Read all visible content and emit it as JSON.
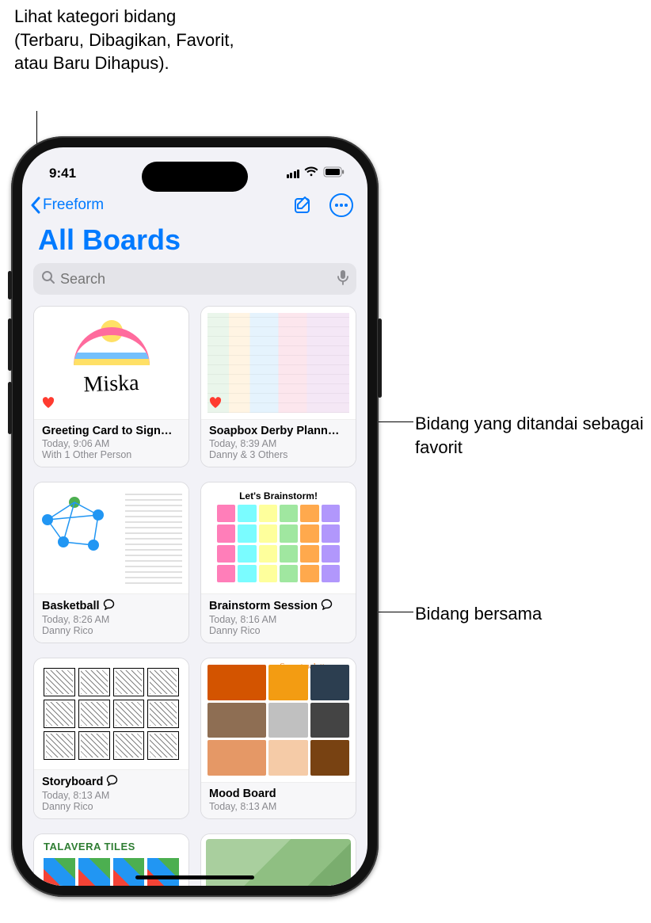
{
  "callouts": {
    "top": "Lihat kategori bidang (Terbaru, Dibagikan, Favorit, atau Baru Dihapus).",
    "favorite": "Bidang yang ditandai sebagai favorit",
    "shared": "Bidang bersama"
  },
  "status": {
    "time": "9:41"
  },
  "nav": {
    "back_label": "Freeform"
  },
  "page": {
    "title": "All Boards"
  },
  "search": {
    "placeholder": "Search"
  },
  "boards": [
    {
      "title": "Greeting Card to Sign…",
      "time": "Today, 9:06 AM",
      "sub": "With 1 Other Person",
      "favorite": true,
      "shared": false,
      "thumb": "rainbow"
    },
    {
      "title": "Soapbox Derby Plann…",
      "time": "Today, 8:39 AM",
      "sub": "Danny & 3 Others",
      "favorite": true,
      "shared": false,
      "thumb": "planning"
    },
    {
      "title": "Basketball",
      "time": "Today, 8:26 AM",
      "sub": "Danny Rico",
      "favorite": false,
      "shared": true,
      "thumb": "basketball"
    },
    {
      "title": "Brainstorm Session",
      "time": "Today, 8:16 AM",
      "sub": "Danny Rico",
      "favorite": false,
      "shared": true,
      "thumb": "brainstorm",
      "brain_heading": "Let's Brainstorm!"
    },
    {
      "title": "Storyboard",
      "time": "Today, 8:13 AM",
      "sub": "Danny Rico",
      "favorite": false,
      "shared": true,
      "thumb": "storyboard"
    },
    {
      "title": "Mood Board",
      "time": "Today, 8:13 AM",
      "sub": "",
      "favorite": false,
      "shared": false,
      "thumb": "mood",
      "mood_heading": "Sunset palettes"
    },
    {
      "title": "",
      "time": "",
      "sub": "",
      "favorite": false,
      "shared": false,
      "thumb": "tiles",
      "tiles_heading": "TALAVERA TILES"
    },
    {
      "title": "",
      "time": "",
      "sub": "",
      "favorite": false,
      "shared": false,
      "thumb": "map"
    }
  ]
}
